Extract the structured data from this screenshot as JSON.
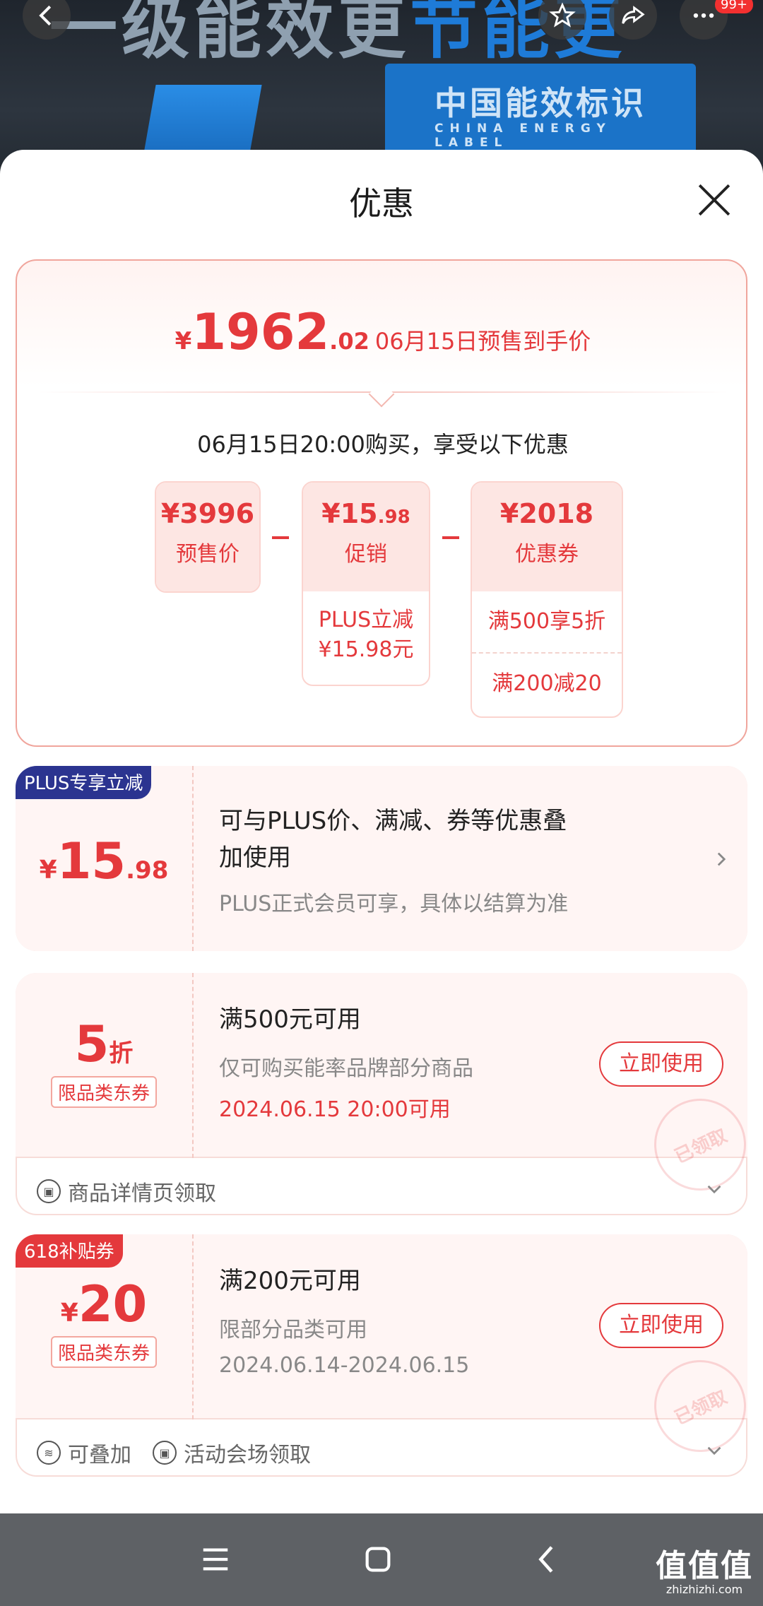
{
  "banner": {
    "slogan_part1": "一级能效更",
    "slogan_part2": "节能更",
    "label_cn": "中国能效标识",
    "label_en": "CHINA ENERGY LABEL",
    "cart_badge": "99+"
  },
  "sheet": {
    "title": "优惠"
  },
  "summary": {
    "yen": "¥",
    "price_int": "1962",
    "price_dec": ".02",
    "price_text": "06月15日预售到手价",
    "subtitle": "06月15日20:00购买，享受以下优惠",
    "cells": [
      {
        "amount": "¥3996",
        "name": "预售价",
        "rows": []
      },
      {
        "amount": "¥15",
        "amount_dec": ".98",
        "name": "促销",
        "rows": [
          "PLUS立减",
          "¥15.98元"
        ]
      },
      {
        "amount": "¥2018",
        "name": "优惠券",
        "rows": [
          "满500享5折",
          "满200减20"
        ]
      }
    ]
  },
  "coupons": [
    {
      "tag": "PLUS专享立减",
      "yen": "¥",
      "value_int": "15",
      "value_dec": ".98",
      "title_line1": "可与PLUS价、满减、券等优惠叠",
      "title_line2": "加使用",
      "desc": "PLUS正式会员可享，具体以结算为准"
    },
    {
      "value": "5",
      "unit": "折",
      "kind": "限品类东券",
      "title": "满500元可用",
      "desc": "仅可购买能率品牌部分商品",
      "date": "2024.06.15 20:00可用",
      "button": "立即使用",
      "stamp": "已领取",
      "footer": "商品详情页领取"
    },
    {
      "tag": "618补贴券",
      "yen": "¥",
      "value": "20",
      "kind": "限品类东券",
      "title": "满200元可用",
      "desc": "限部分品类可用",
      "date": "2024.06.14-2024.06.15",
      "button": "立即使用",
      "stamp": "已领取",
      "footer1": "可叠加",
      "footer2": "活动会场领取"
    }
  ],
  "watermark": {
    "line1": "值值值",
    "line2": "zhizhizhi.com"
  },
  "colors": {
    "accent": "#e4393c",
    "plus_tag": "#2b3490",
    "nav": "#5e6165"
  }
}
